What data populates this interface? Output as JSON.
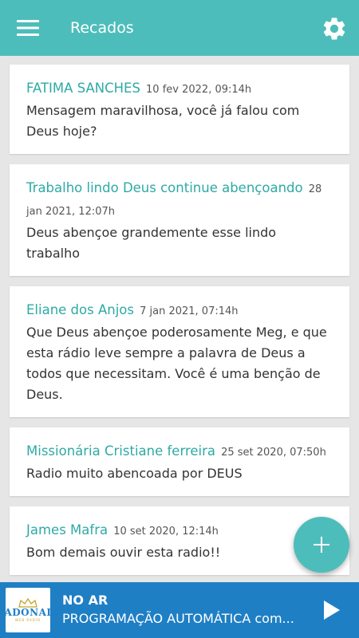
{
  "header": {
    "title": "Recados"
  },
  "messages": [
    {
      "author": "FATIMA SANCHES",
      "time": "10 fev 2022, 09:14h",
      "text": "Mensagem maravilhosa, você já falou com Deus hoje?"
    },
    {
      "author": "Trabalho lindo Deus continue abençoando",
      "time": "28 jan 2021, 12:07h",
      "text": "Deus abençoe grandemente esse lindo trabalho"
    },
    {
      "author": "Eliane dos Anjos",
      "time": "7 jan 2021, 07:14h",
      "text": "Que Deus abençoe poderosamente Meg, e que esta rádio leve sempre a palavra de Deus a todos que necessitam. Você é uma benção de Deus."
    },
    {
      "author": "Missionária Cristiane ferreira",
      "time": "25 set 2020, 07:50h",
      "text": "Radio muito abencoada por DEUS"
    },
    {
      "author": "James Mafra",
      "time": "10 set 2020, 12:14h",
      "text": "Bom demais ouvir esta radio!!"
    }
  ],
  "player": {
    "logo_text": "ADONAI",
    "logo_subtext": "WEB RADIO",
    "status": "NO AR",
    "program": "PROGRAMAÇÃO AUTOMÁTICA com..."
  },
  "colors": {
    "primary": "#4dbdbb",
    "author": "#2eaaa5",
    "player": "#1f7fc5"
  },
  "icons": {
    "menu": "hamburger-icon",
    "settings": "gear-icon",
    "add": "plus-icon",
    "play": "play-icon"
  }
}
